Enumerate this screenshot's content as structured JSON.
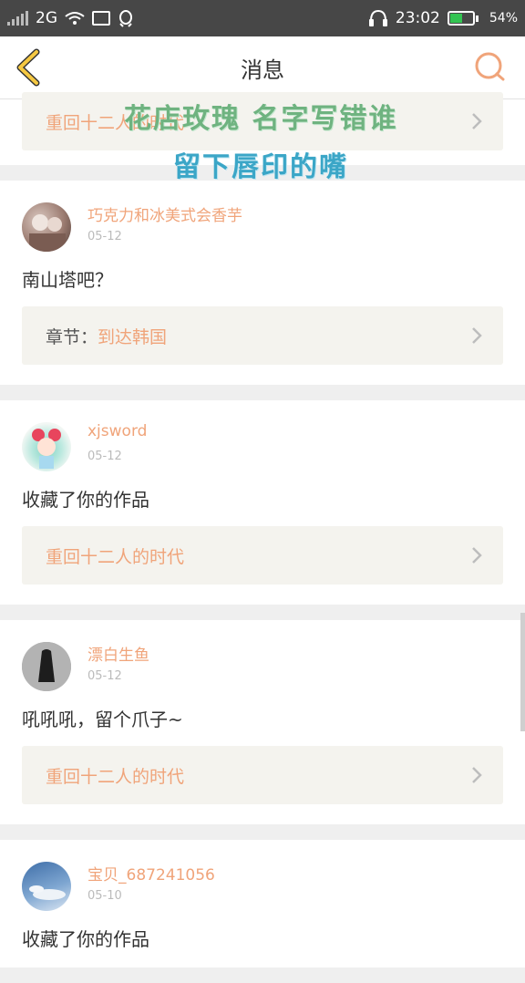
{
  "status_bar": {
    "network": "2G",
    "time": "23:02",
    "battery": "54%",
    "battery_level": 0.54,
    "colors": {
      "background": "#474747",
      "battery_fill": "#33c452"
    }
  },
  "header": {
    "title": "消息",
    "back_icon": "chevron-left-icon",
    "search_icon": "search-icon",
    "colors": {
      "back": "#f5c842",
      "search": "#f0a47a"
    }
  },
  "overlay": {
    "line1": "花店玫瑰 名字写错谁",
    "line2": "留下唇印的嘴"
  },
  "feed": {
    "first_card": {
      "chapter_title": "重回十二人的时代"
    },
    "items": [
      {
        "username": "巧克力和冰美式会香芋",
        "time": "05-12",
        "message": "南山塔吧？",
        "chapter_prefix": "章节：",
        "chapter_title": "到达韩国"
      },
      {
        "username": "xjsword",
        "time": "05-12",
        "message": "收藏了你的作品",
        "chapter_prefix": "",
        "chapter_title": "重回十二人的时代"
      },
      {
        "username": "漂白生鱼",
        "time": "05-12",
        "message": "吼吼吼，留个爪子~",
        "chapter_prefix": "",
        "chapter_title": "重回十二人的时代"
      },
      {
        "username": "宝贝_687241056",
        "time": "05-10",
        "message": "收藏了你的作品"
      }
    ]
  },
  "colors": {
    "accent": "#f0a47a",
    "text": "#333333",
    "muted": "#bbbbbb",
    "chapter_bg": "#f4f3ee",
    "page_bg": "#efefef"
  }
}
